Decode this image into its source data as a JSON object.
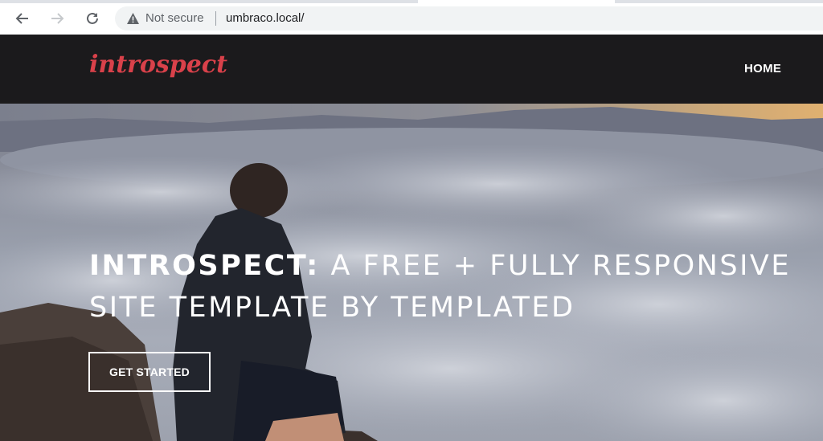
{
  "browser": {
    "security_label": "Not secure",
    "url": "umbraco.local/",
    "icons": [
      "back-arrow-icon",
      "forward-arrow-icon",
      "reload-icon",
      "warning-icon"
    ]
  },
  "site": {
    "logo_text": "introspect",
    "nav": {
      "home_label": "HOME"
    },
    "colors": {
      "header_bg": "#1b1a1c",
      "logo": "#d9414a",
      "text": "#ffffff"
    }
  },
  "hero": {
    "title_strong": "INTROSPECT:",
    "title_rest": " A FREE + FULLY RESPONSIVE SITE TEMPLATE BY TEMPLATED",
    "cta_label": "GET STARTED"
  }
}
